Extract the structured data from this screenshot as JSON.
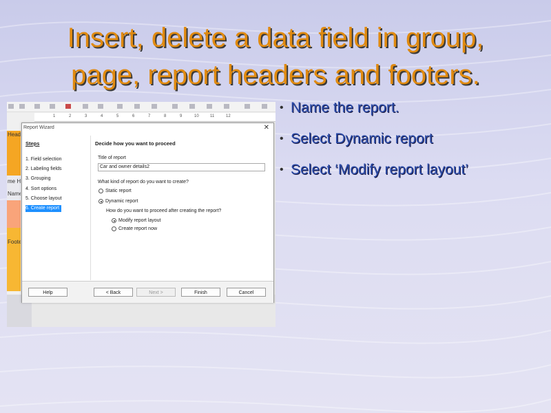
{
  "slide": {
    "title_line1": "Insert, delete a data field in group,",
    "title_line2": "page, report headers and footers.",
    "bullets": [
      "Name the report.",
      "Select Dynamic report",
      "Select ‘Modify report layout’"
    ]
  },
  "report_bands": [
    "Header",
    "me He",
    "Name",
    "Footer"
  ],
  "ruler_ticks": [
    "1",
    "2",
    "3",
    "4",
    "5",
    "6",
    "7",
    "8",
    "9",
    "10",
    "11",
    "12"
  ],
  "wizard": {
    "window_title": "Report Wizard",
    "close_glyph": "✕",
    "steps_heading": "Steps",
    "steps": [
      "1. Field selection",
      "2. Labeling fields",
      "3. Grouping",
      "4. Sort options",
      "5. Choose layout",
      "6. Create report"
    ],
    "active_step": 5,
    "heading": "Decide how you want to proceed",
    "title_label": "Title of report",
    "title_value": "Car and owner details2",
    "kind_question": "What kind of report do you want to create?",
    "option_static": "Static report",
    "option_dynamic": "Dynamic report",
    "proceed_question": "How do you want to proceed after creating the report?",
    "option_modify": "Modify report layout",
    "option_create_now": "Create report now",
    "buttons": {
      "help": "Help",
      "back": "< Back",
      "next": "Next >",
      "finish": "Finish",
      "cancel": "Cancel"
    }
  },
  "colors": {
    "title": "#e08a10",
    "bullets": "#2a4aa8",
    "band_orange": "#f5a623",
    "active_step": "#1e90ff"
  }
}
